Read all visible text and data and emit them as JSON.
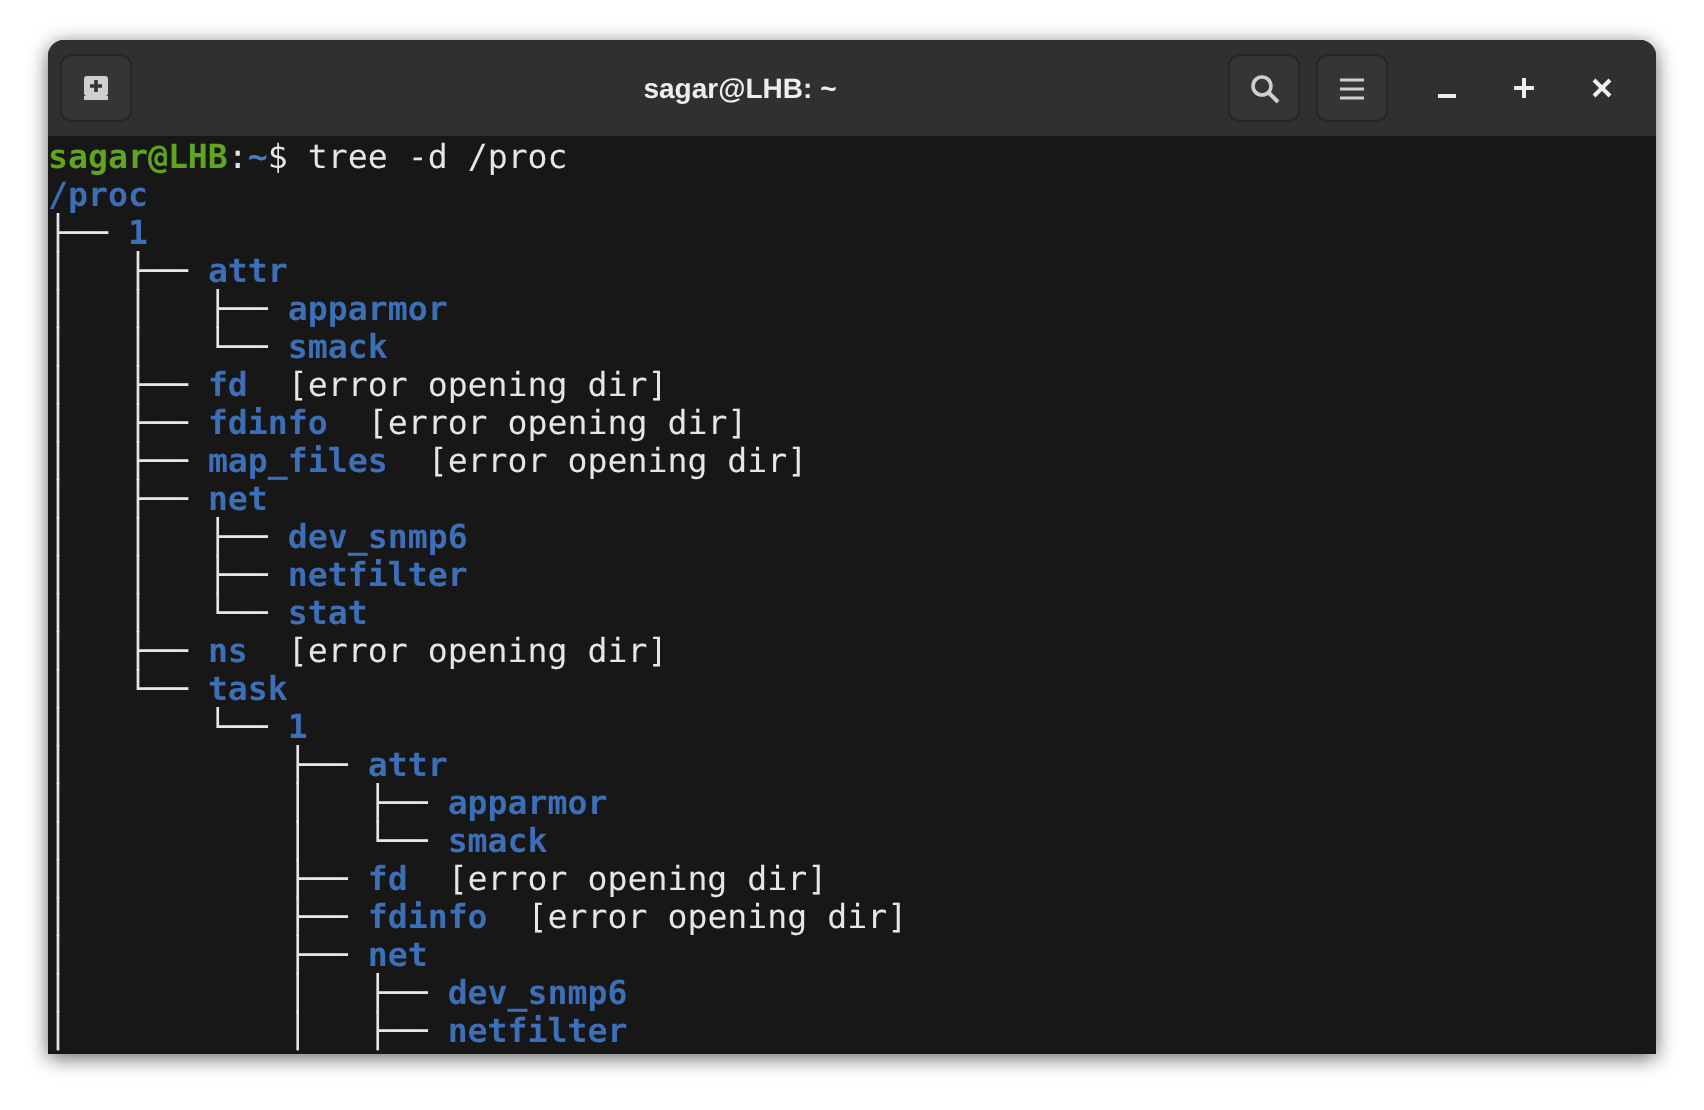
{
  "window": {
    "title": "sagar@LHB: ~"
  },
  "prompt": {
    "user_host": "sagar@LHB",
    "separator": ":",
    "path": "~",
    "symbol": "$",
    "command": " tree -d /proc"
  },
  "output": [
    {
      "name": "/proc"
    },
    {
      "tree": "├── ",
      "name": "1"
    },
    {
      "tree": "│   ├── ",
      "name": "attr"
    },
    {
      "tree": "│   │   ├── ",
      "name": "apparmor"
    },
    {
      "tree": "│   │   └── ",
      "name": "smack"
    },
    {
      "tree": "│   ├── ",
      "name": "fd",
      "note": "[error opening dir]"
    },
    {
      "tree": "│   ├── ",
      "name": "fdinfo",
      "note": "[error opening dir]"
    },
    {
      "tree": "│   ├── ",
      "name": "map_files",
      "note": "[error opening dir]"
    },
    {
      "tree": "│   ├── ",
      "name": "net"
    },
    {
      "tree": "│   │   ├── ",
      "name": "dev_snmp6"
    },
    {
      "tree": "│   │   ├── ",
      "name": "netfilter"
    },
    {
      "tree": "│   │   └── ",
      "name": "stat"
    },
    {
      "tree": "│   ├── ",
      "name": "ns",
      "note": "[error opening dir]"
    },
    {
      "tree": "│   └── ",
      "name": "task"
    },
    {
      "tree": "│       └── ",
      "name": "1"
    },
    {
      "tree": "│           ├── ",
      "name": "attr"
    },
    {
      "tree": "│           │   ├── ",
      "name": "apparmor"
    },
    {
      "tree": "│           │   └── ",
      "name": "smack"
    },
    {
      "tree": "│           ├── ",
      "name": "fd",
      "note": "[error opening dir]"
    },
    {
      "tree": "│           ├── ",
      "name": "fdinfo",
      "note": "[error opening dir]"
    },
    {
      "tree": "│           ├── ",
      "name": "net"
    },
    {
      "tree": "│           │   ├── ",
      "name": "dev_snmp6"
    },
    {
      "tree": "│           │   ├── ",
      "name": "netfilter"
    }
  ]
}
